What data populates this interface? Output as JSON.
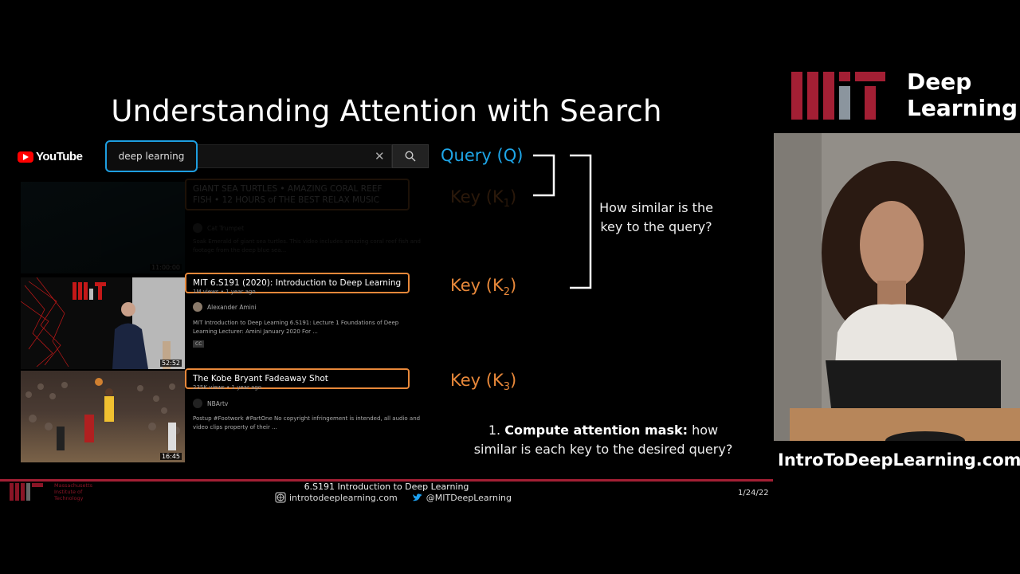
{
  "slide": {
    "title": "Understanding Attention with Search"
  },
  "youtube": {
    "logo_text": "YouTube",
    "search_value": "deep learning",
    "clear_glyph": "✕"
  },
  "results": [
    {
      "title": "GIANT SEA TURTLES • AMAZING CORAL REEF FISH • 12 HOURS of THE BEST RELAX MUSIC",
      "meta": "8.4M views • 1 year ago",
      "channel": "Cat Trumpet",
      "description": "Soak Emerald of giant sea turtles. This video includes amazing coral reef fish and footage from the deep blue sea...",
      "duration": "11:00:00"
    },
    {
      "title": "MIT 6.S191 (2020): Introduction to Deep Learning",
      "meta": "1M views • 1 year ago",
      "channel": "Alexander Amini",
      "description": "MIT Introduction to Deep Learning 6.S191: Lecture 1 Foundations of Deep Learning Lecturer: Amini January 2020 For ...",
      "badge": "CC",
      "duration": "52:52"
    },
    {
      "title": "The Kobe Bryant Fadeaway Shot",
      "meta": "235K views • 1 year ago",
      "channel": "NBArtv",
      "description": "Postup #Footwork #PartOne No copyright infringement is intended, all audio and video clips property of their ...",
      "duration": "16:45"
    }
  ],
  "labels": {
    "query": "Query (Q)",
    "key1": "Key (K",
    "key1_sub": "1",
    "key2": "Key (K",
    "key2_sub": "2",
    "key3": "Key (K",
    "key3_sub": "3",
    "close_paren": ")",
    "how_similar": "How similar is the key to the query?",
    "compute_num": "1. ",
    "compute_bold": "Compute attention mask:",
    "compute_rest": " how similar is each key to the desired query?"
  },
  "footer": {
    "institute": [
      "Massachusetts",
      "Institute of",
      "Technology"
    ],
    "course": "6.S191 Introduction to Deep Learning",
    "website": "introtodeeplearning.com",
    "twitter": "@MITDeepLearning",
    "date": "1/24/22"
  },
  "branding": {
    "line1": "Deep",
    "line2": "Learning",
    "url": "IntroToDeepLearning.com"
  },
  "colors": {
    "query_blue": "#1ea6e8",
    "key_orange": "#e8883a",
    "mit_red": "#a31f34"
  }
}
